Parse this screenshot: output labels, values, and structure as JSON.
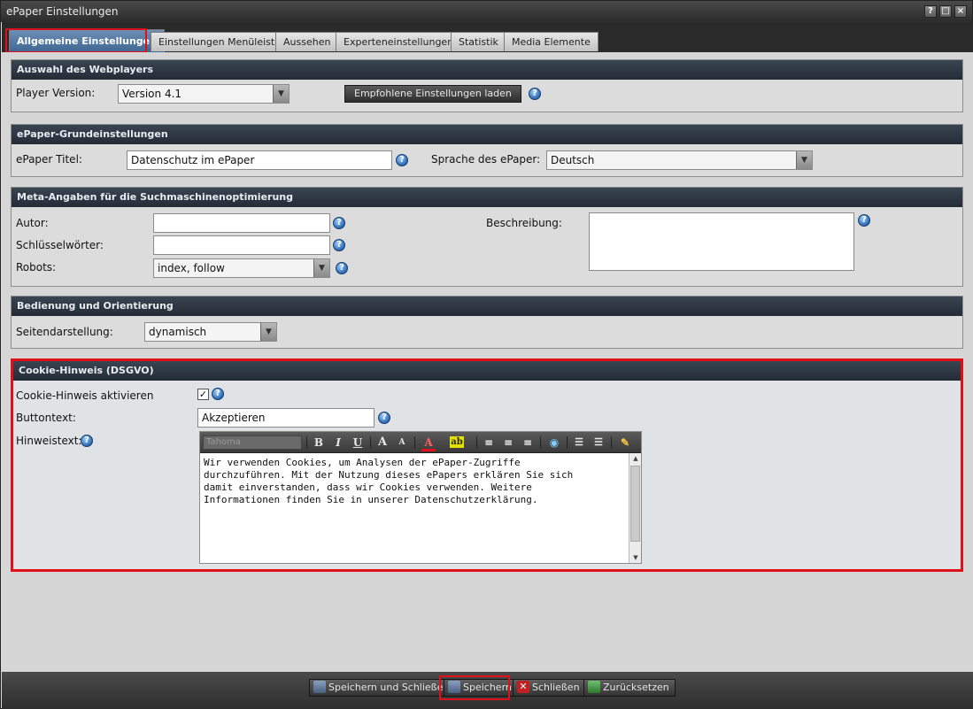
{
  "window": {
    "title": "ePaper Einstellungen"
  },
  "title_buttons": [
    "?",
    "□",
    "×"
  ],
  "tabs": [
    {
      "label": "Allgemeine Einstellungen",
      "active": true
    },
    {
      "label": "Einstellungen Menüleiste"
    },
    {
      "label": "Aussehen"
    },
    {
      "label": "Experteneinstellungen"
    },
    {
      "label": "Statistik"
    },
    {
      "label": "Media Elemente"
    }
  ],
  "webplayer": {
    "heading": "Auswahl des Webplayers",
    "player_label": "Player Version:",
    "player_value": "Version 4.1",
    "load_button": "Empfohlene Einstellungen laden"
  },
  "grund": {
    "heading": "ePaper-Grundeinstellungen",
    "title_label": "ePaper Titel:",
    "title_value": "Datenschutz im ePaper",
    "lang_label": "Sprache des ePaper:",
    "lang_value": "Deutsch"
  },
  "meta": {
    "heading": "Meta-Angaben für die Suchmaschinenoptimierung",
    "author_label": "Autor:",
    "author_value": "",
    "keywords_label": "Schlüsselwörter:",
    "keywords_value": "",
    "robots_label": "Robots:",
    "robots_value": "index, follow",
    "desc_label": "Beschreibung:"
  },
  "bedienung": {
    "heading": "Bedienung und Orientierung",
    "page_label": "Seitendarstellung:",
    "page_value": "dynamisch"
  },
  "cookie": {
    "heading": "Cookie-Hinweis (DSGVO)",
    "activate_label": "Cookie-Hinweis aktivieren",
    "activate_checked": true,
    "buttontext_label": "Buttontext:",
    "buttontext_value": "Akzeptieren",
    "hinweis_label": "Hinweistext:",
    "hinweis_text": "Wir verwenden Cookies, um Analysen der ePaper-Zugriffe\ndurchzuführen. Mit der Nutzung dieses ePapers erklären Sie sich\ndamit einverstanden, dass wir Cookies verwenden. Weitere\nInformationen finden Sie in unserer Datenschutzerklärung.",
    "editor_font_placeholder": "Tahoma"
  },
  "footer": {
    "save_close": "Speichern und Schließen",
    "save": "Speichern",
    "close": "Schließen",
    "reset": "Zurücksetzen"
  }
}
